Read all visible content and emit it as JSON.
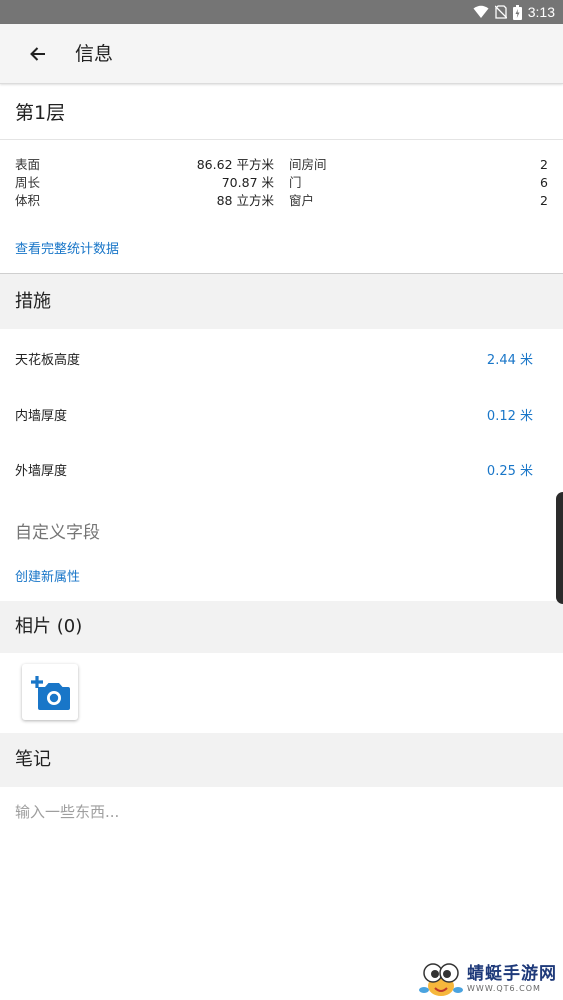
{
  "status_bar": {
    "time": "3:13"
  },
  "app_bar": {
    "title": "信息"
  },
  "floor": {
    "title": "第1层"
  },
  "stats": {
    "left": [
      {
        "label": "表面",
        "value": "86.62 平方米"
      },
      {
        "label": "周长",
        "value": "70.87 米"
      },
      {
        "label": "体积",
        "value": "88 立方米"
      }
    ],
    "right": [
      {
        "label": "间房间",
        "value": "2"
      },
      {
        "label": "门",
        "value": "6"
      },
      {
        "label": "窗户",
        "value": "2"
      }
    ],
    "view_full_link": "查看完整统计数据"
  },
  "measures": {
    "title": "措施",
    "items": [
      {
        "label": "天花板高度",
        "value": "2.44 米"
      },
      {
        "label": "内墙厚度",
        "value": "0.12 米"
      },
      {
        "label": "外墙厚度",
        "value": "0.25 米"
      }
    ]
  },
  "custom_fields": {
    "title": "自定义字段",
    "create_link": "创建新属性"
  },
  "photos": {
    "title": "相片 (0)"
  },
  "notes": {
    "title": "笔记",
    "placeholder": "输入一些东西..."
  },
  "watermark": {
    "main": "蜻蜓手游网",
    "sub": "WWW.QT6.COM"
  },
  "colors": {
    "accent": "#1976c8",
    "status_bar": "#757575",
    "section_bg": "#f2f2f2"
  }
}
